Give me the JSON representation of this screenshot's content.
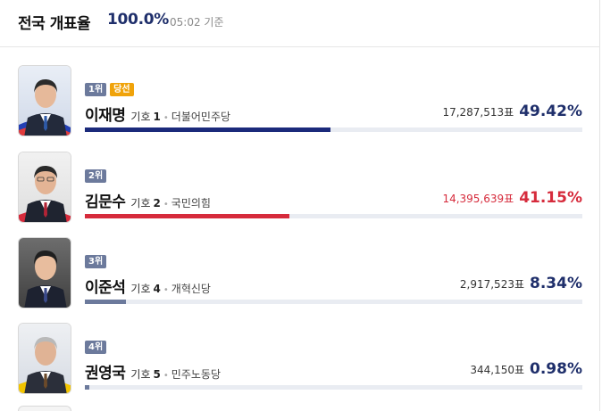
{
  "header": {
    "title": "전국 개표율",
    "rate": "100.0%",
    "time": "05:02",
    "time_suffix": "기준"
  },
  "candidates": [
    {
      "rank": "1위",
      "elected": "당선",
      "name": "이재명",
      "num_label": "기호",
      "number": "1",
      "dot": "•",
      "party": "더불어민주당",
      "votes": "17,287,513표",
      "pct": "49.42%",
      "share": 0.4942,
      "color": "#1b2a7b",
      "pct_color": "#1f2f6b",
      "votes_color": "#333333"
    },
    {
      "rank": "2위",
      "name": "김문수",
      "num_label": "기호",
      "number": "2",
      "dot": "•",
      "party": "국민의힘",
      "votes": "14,395,639표",
      "pct": "41.15%",
      "share": 0.4115,
      "color": "#d62b3c",
      "pct_color": "#d62b3c",
      "votes_color": "#d62b3c"
    },
    {
      "rank": "3위",
      "name": "이준석",
      "num_label": "기호",
      "number": "4",
      "dot": "•",
      "party": "개혁신당",
      "votes": "2,917,523표",
      "pct": "8.34%",
      "share": 0.0834,
      "color": "#6c7a9c",
      "pct_color": "#1f2f6b",
      "votes_color": "#333333"
    },
    {
      "rank": "4위",
      "name": "권영국",
      "num_label": "기호",
      "number": "5",
      "dot": "•",
      "party": "민주노동당",
      "votes": "344,150표",
      "pct": "0.98%",
      "share": 0.0098,
      "color": "#6c7a9c",
      "pct_color": "#1f2f6b",
      "votes_color": "#333333"
    }
  ]
}
